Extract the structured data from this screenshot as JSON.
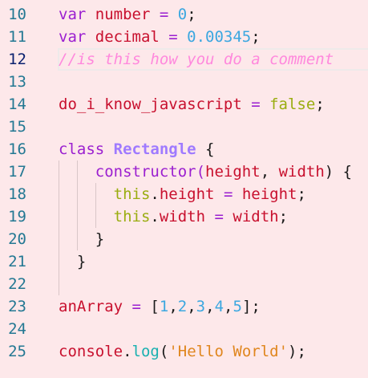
{
  "colors": {
    "background": "#fde8ea",
    "keyword": "#9b1fd0",
    "identifier": "#c8102e",
    "number": "#3ba7e0",
    "comment": "#ff88dd",
    "literal": "#9aad10",
    "class_name": "#9f7aff",
    "punctuation": "#1a1a1a",
    "function": "#19b0b0",
    "string": "#e0861e"
  },
  "current_line": 12,
  "lines": [
    {
      "n": "10",
      "tokens": [
        [
          "var ",
          "keyword"
        ],
        [
          "number ",
          "identifier"
        ],
        [
          "= ",
          "keyword"
        ],
        [
          "0",
          "number"
        ],
        [
          ";",
          "punctuation"
        ]
      ]
    },
    {
      "n": "11",
      "tokens": [
        [
          "var ",
          "keyword"
        ],
        [
          "decimal ",
          "identifier"
        ],
        [
          "= ",
          "keyword"
        ],
        [
          "0.00345",
          "number"
        ],
        [
          ";",
          "punctuation"
        ]
      ]
    },
    {
      "n": "12",
      "tokens": [
        [
          "//is this how you do a comment",
          "comment"
        ]
      ]
    },
    {
      "n": "13",
      "tokens": []
    },
    {
      "n": "14",
      "tokens": [
        [
          "do_i_know_javascript ",
          "identifier"
        ],
        [
          "= ",
          "keyword"
        ],
        [
          "false",
          "literal"
        ],
        [
          ";",
          "punctuation"
        ]
      ]
    },
    {
      "n": "15",
      "tokens": []
    },
    {
      "n": "16",
      "tokens": [
        [
          "class ",
          "keyword"
        ],
        [
          "Rectangle ",
          "class_name"
        ],
        [
          "{",
          "punctuation"
        ]
      ]
    },
    {
      "n": "17",
      "tokens": [
        [
          "    ",
          "punctuation"
        ],
        [
          "constructor(",
          "keyword"
        ],
        [
          "height",
          "identifier"
        ],
        [
          ", ",
          "punctuation"
        ],
        [
          "width",
          "identifier"
        ],
        [
          ") {",
          "punctuation"
        ]
      ]
    },
    {
      "n": "18",
      "tokens": [
        [
          "      ",
          "punctuation"
        ],
        [
          "this",
          "literal"
        ],
        [
          ".",
          "punctuation"
        ],
        [
          "height ",
          "identifier"
        ],
        [
          "= ",
          "keyword"
        ],
        [
          "height",
          "identifier"
        ],
        [
          ";",
          "punctuation"
        ]
      ]
    },
    {
      "n": "19",
      "tokens": [
        [
          "      ",
          "punctuation"
        ],
        [
          "this",
          "literal"
        ],
        [
          ".",
          "punctuation"
        ],
        [
          "width ",
          "identifier"
        ],
        [
          "= ",
          "keyword"
        ],
        [
          "width",
          "identifier"
        ],
        [
          ";",
          "punctuation"
        ]
      ]
    },
    {
      "n": "20",
      "tokens": [
        [
          "    }",
          "punctuation"
        ]
      ]
    },
    {
      "n": "21",
      "tokens": [
        [
          "  }",
          "punctuation"
        ]
      ]
    },
    {
      "n": "22",
      "tokens": []
    },
    {
      "n": "23",
      "tokens": [
        [
          "anArray ",
          "identifier"
        ],
        [
          "= ",
          "keyword"
        ],
        [
          "[",
          "punctuation"
        ],
        [
          "1",
          "number"
        ],
        [
          ",",
          "punctuation"
        ],
        [
          "2",
          "number"
        ],
        [
          ",",
          "punctuation"
        ],
        [
          "3",
          "number"
        ],
        [
          ",",
          "punctuation"
        ],
        [
          "4",
          "number"
        ],
        [
          ",",
          "punctuation"
        ],
        [
          "5",
          "number"
        ],
        [
          "];",
          "punctuation"
        ]
      ]
    },
    {
      "n": "24",
      "tokens": []
    },
    {
      "n": "25",
      "tokens": [
        [
          "console",
          "identifier"
        ],
        [
          ".",
          "punctuation"
        ],
        [
          "log",
          "function"
        ],
        [
          "(",
          "punctuation"
        ],
        [
          "'Hello World'",
          "string"
        ],
        [
          ");",
          "punctuation"
        ]
      ]
    }
  ]
}
